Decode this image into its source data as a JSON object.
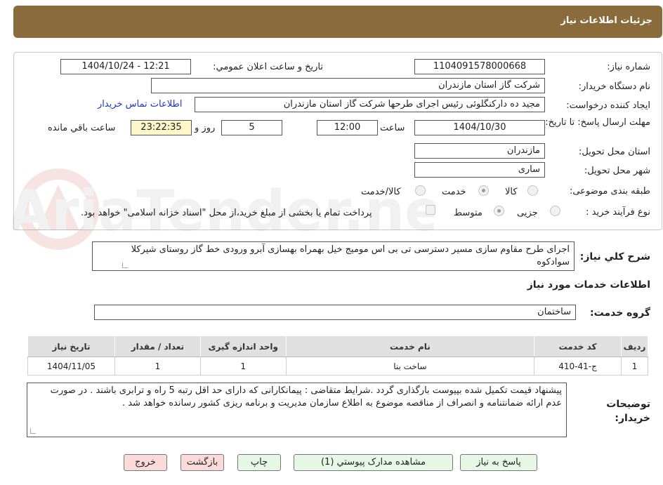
{
  "header": {
    "title": "جزئیات اطلاعات نیاز"
  },
  "form": {
    "need_number_label": "شماره نیاز:",
    "need_number": "1104091578000668",
    "announce_label": "تاریخ و ساعت اعلان عمومي:",
    "announce_value": "1404/10/24 - 12:21",
    "buyer_org_label": "نام دستگاه خریدار:",
    "buyer_org": "شرکت گاز استان مازندران",
    "creator_label": "ایجاد کننده درخواست:",
    "creator": "مجید ده دارکنگلوئی رئیس اجرای طرحها شرکت گاز استان مازندران",
    "contact_link": "اطلاعات تماس خریدار",
    "deadline_label": "مهلت ارسال پاسخ: تا تاریخ:",
    "deadline_date": "1404/10/30",
    "time_label": "ساعت",
    "deadline_time": "12:00",
    "days_value": "5",
    "days_label": "روز و",
    "remaining_time": "23:22:35",
    "remaining_label": "ساعت باقي مانده",
    "province_label": "استان محل تحویل:",
    "province": "مازندران",
    "city_label": "شهر محل تحویل:",
    "city": "ساری",
    "category_label": "طبقه بندی موضوعی:",
    "category_options": [
      "کالا",
      "خدمت",
      "کالا/خدمت"
    ],
    "category_selected": "خدمت",
    "process_label": "نوع فرآیند خرید :",
    "process_options": [
      "جزیی",
      "متوسط"
    ],
    "process_selected": "متوسط",
    "treasury_note": "پرداخت تمام یا بخشی از مبلغ خرید،از محل \"اسناد خزانه اسلامی\" خواهد بود."
  },
  "description": {
    "label": "شرح کلي نیاز:",
    "text": "اجرای طرح مقاوم سازی مسیر دسترسی تی بی اس مومیج خیل بهمراه بهسازی آبرو ورودی خط گاز روستای شیرکلا سوادکوه"
  },
  "services": {
    "section_title": "اطلاعات خدمات مورد نیاز",
    "group_label": "گروه خدمت:",
    "group_value": "ساختمان",
    "columns": [
      "ردیف",
      "کد خدمت",
      "نام خدمت",
      "واحد اندازه گیری",
      "تعداد / مقدار",
      "تاریخ نیاز"
    ],
    "rows": [
      [
        "1",
        "ج-41-410",
        "ساخت بنا",
        "1",
        "1",
        "1404/11/05"
      ]
    ]
  },
  "buyer_notes": {
    "label": "توضیحات خریدار:",
    "text": "پیشنهاد قیمت تکمیل شده بپیوست  بارگذاری گردد .شرایط متقاضی : پیمانکارانی که دارای حد اقل رتبه 5 راه و ترابری باشند . در صورت عدم ارائه ضمانتنامه و انصراف از مناقصه موضوع به اطلاع سازمان مدیریت و برنامه ریزی کشور رسانده خواهد شد ."
  },
  "buttons": {
    "reply": "پاسخ به نیاز",
    "attachments": "مشاهده مدارک پیوستي (1)",
    "print": "چاپ",
    "back": "بازگشت",
    "exit": "خروج"
  },
  "watermark": {
    "text": "AriaTender.neT"
  },
  "colors": {
    "header_bg": "#8a6b3b",
    "button_green": "#e6f7e6",
    "button_red": "#fbdada",
    "link": "#1a37c7",
    "timer_bg": "#fcf6c8"
  }
}
